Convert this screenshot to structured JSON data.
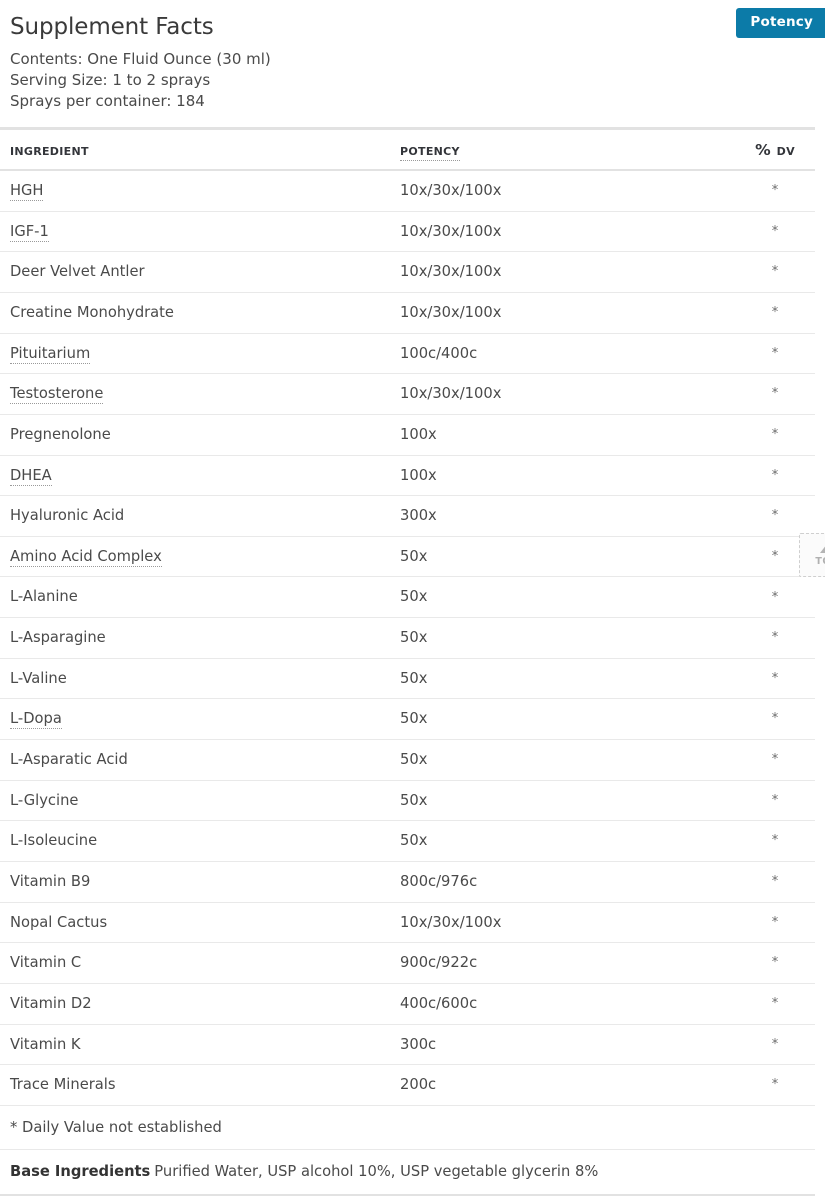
{
  "badge": {
    "label": "Potency",
    "color": "#0c7ba8",
    "text_color": "#ffffff"
  },
  "header": {
    "title": "Supplement Facts",
    "contents": "Contents: One Fluid Ounce (30 ml)",
    "serving_size": "Serving Size: 1 to 2 sprays",
    "sprays_per_container": "Sprays per container: 184"
  },
  "table": {
    "columns": {
      "ingredient": "Ingredient",
      "potency": "Potency",
      "dv": "% DV"
    },
    "potency_header_has_glossary_underline": true,
    "rows": [
      {
        "ingredient": "HGH",
        "glossary": true,
        "potency": "10x/30x/100x",
        "dv": "*"
      },
      {
        "ingredient": "IGF-1",
        "glossary": true,
        "potency": "10x/30x/100x",
        "dv": "*"
      },
      {
        "ingredient": "Deer Velvet Antler",
        "glossary": false,
        "potency": "10x/30x/100x",
        "dv": "*"
      },
      {
        "ingredient": "Creatine Monohydrate",
        "glossary": false,
        "potency": "10x/30x/100x",
        "dv": "*"
      },
      {
        "ingredient": "Pituitarium",
        "glossary": true,
        "potency": "100c/400c",
        "dv": "*"
      },
      {
        "ingredient": "Testosterone",
        "glossary": true,
        "potency": "10x/30x/100x",
        "dv": "*"
      },
      {
        "ingredient": "Pregnenolone",
        "glossary": false,
        "potency": "100x",
        "dv": "*"
      },
      {
        "ingredient": "DHEA",
        "glossary": true,
        "potency": "100x",
        "dv": "*"
      },
      {
        "ingredient": "Hyaluronic Acid",
        "glossary": false,
        "potency": "300x",
        "dv": "*"
      },
      {
        "ingredient": "Amino Acid Complex",
        "glossary": true,
        "potency": "50x",
        "dv": "*"
      },
      {
        "ingredient": "L-Alanine",
        "glossary": false,
        "potency": "50x",
        "dv": "*"
      },
      {
        "ingredient": "L-Asparagine",
        "glossary": false,
        "potency": "50x",
        "dv": "*"
      },
      {
        "ingredient": "L-Valine",
        "glossary": false,
        "potency": "50x",
        "dv": "*"
      },
      {
        "ingredient": "L-Dopa",
        "glossary": true,
        "potency": "50x",
        "dv": "*"
      },
      {
        "ingredient": "L-Asparatic Acid",
        "glossary": false,
        "potency": "50x",
        "dv": "*"
      },
      {
        "ingredient": "L-Glycine",
        "glossary": false,
        "potency": "50x",
        "dv": "*"
      },
      {
        "ingredient": "L-Isoleucine",
        "glossary": false,
        "potency": "50x",
        "dv": "*"
      },
      {
        "ingredient": "Vitamin B9",
        "glossary": false,
        "potency": "800c/976c",
        "dv": "*"
      },
      {
        "ingredient": "Nopal Cactus",
        "glossary": false,
        "potency": "10x/30x/100x",
        "dv": "*"
      },
      {
        "ingredient": "Vitamin C",
        "glossary": false,
        "potency": "900c/922c",
        "dv": "*"
      },
      {
        "ingredient": "Vitamin D2",
        "glossary": false,
        "potency": "400c/600c",
        "dv": "*"
      },
      {
        "ingredient": "Vitamin K",
        "glossary": false,
        "potency": "300c",
        "dv": "*"
      },
      {
        "ingredient": "Trace Minerals",
        "glossary": false,
        "potency": "200c",
        "dv": "*"
      }
    ]
  },
  "footnotes": {
    "daily_value": "* Daily Value not established",
    "base_label": "Base Ingredients",
    "base_value": "Purified Water, USP alcohol 10%, USP vegetable glycerin 8%"
  },
  "back_to_top": {
    "label": "TOP",
    "icon": "arrow-up-icon"
  }
}
